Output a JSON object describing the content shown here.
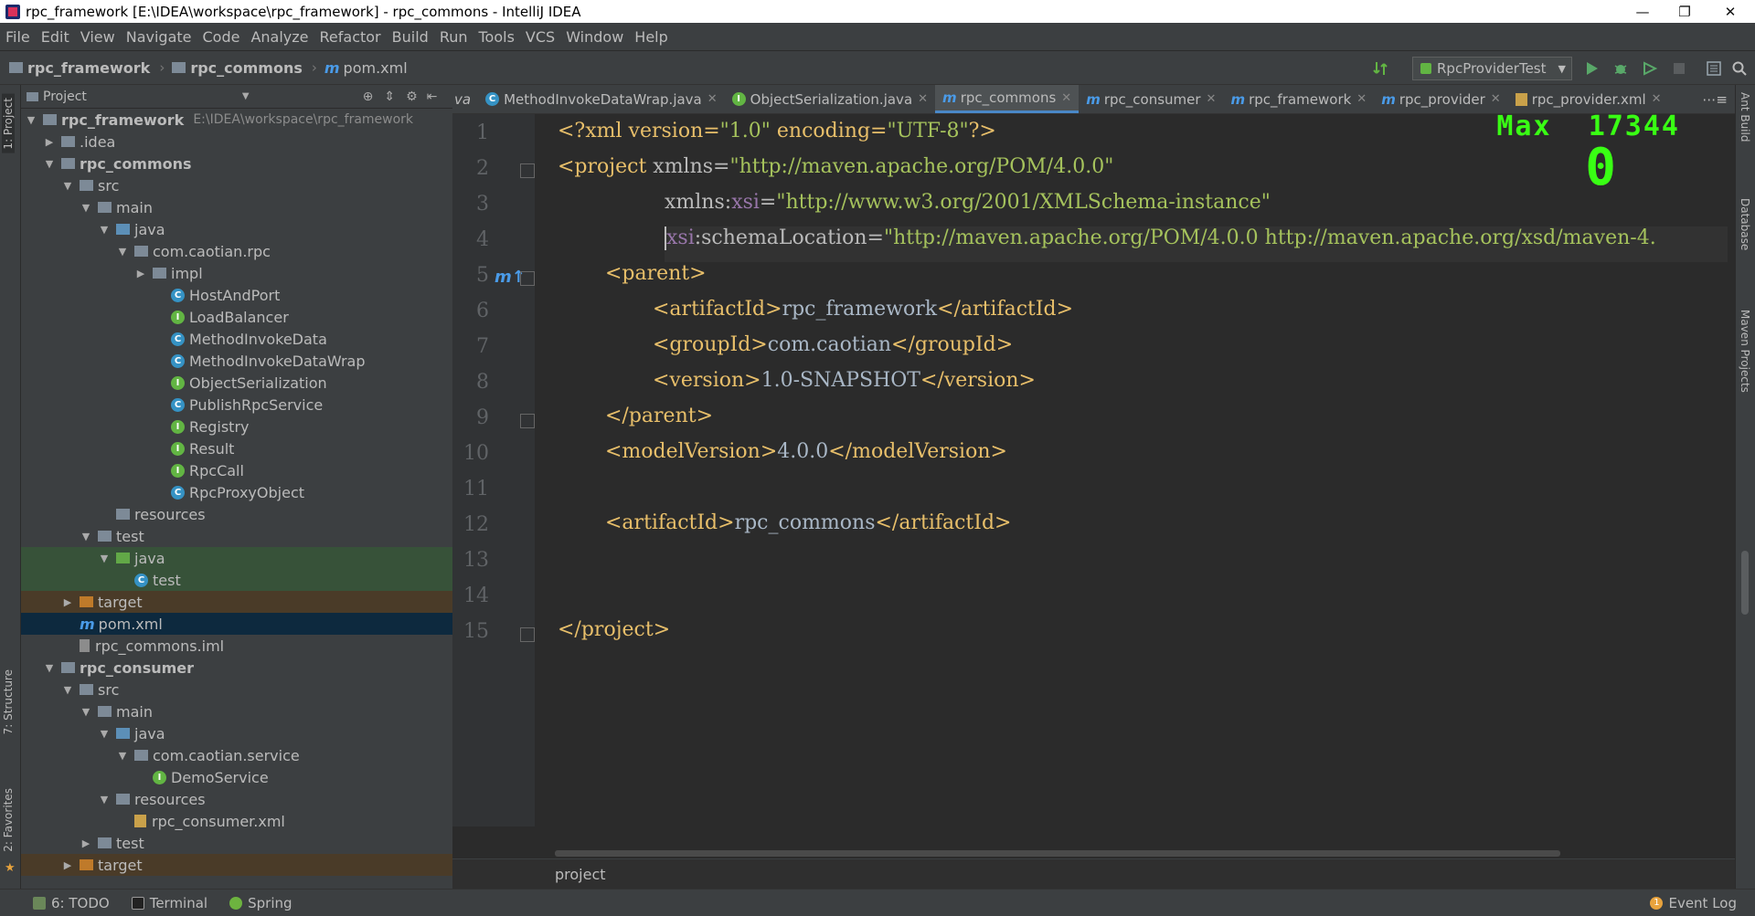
{
  "window": {
    "title": "rpc_framework [E:\\IDEA\\workspace\\rpc_framework] - rpc_commons - IntelliJ IDEA",
    "minimize": "—",
    "restore": "❐",
    "close": "✕"
  },
  "menu": [
    "File",
    "Edit",
    "View",
    "Navigate",
    "Code",
    "Analyze",
    "Refactor",
    "Build",
    "Run",
    "Tools",
    "VCS",
    "Window",
    "Help"
  ],
  "breadcrumb": {
    "root": "rpc_framework",
    "module": "rpc_commons",
    "file": "pom.xml"
  },
  "run_config": "RpcProviderTest",
  "project_panel": {
    "title": "Project"
  },
  "tree": [
    {
      "label": "rpc_framework",
      "extra": "E:\\IDEA\\workspace\\rpc_framework",
      "icon": "module",
      "expanded": true,
      "bold": true
    },
    {
      "label": ".idea",
      "icon": "folder",
      "expanded": false
    },
    {
      "label": "rpc_commons",
      "icon": "module",
      "expanded": true,
      "bold": true
    },
    {
      "label": "src",
      "icon": "folder",
      "expanded": true
    },
    {
      "label": "main",
      "icon": "folder",
      "expanded": true
    },
    {
      "label": "java",
      "icon": "folder-src",
      "expanded": true
    },
    {
      "label": "com.caotian.rpc",
      "icon": "package",
      "expanded": true
    },
    {
      "label": "impl",
      "icon": "package",
      "expanded": false
    },
    {
      "label": "HostAndPort",
      "icon": "class"
    },
    {
      "label": "LoadBalancer",
      "icon": "interface"
    },
    {
      "label": "MethodInvokeData",
      "icon": "class"
    },
    {
      "label": "MethodInvokeDataWrap",
      "icon": "class"
    },
    {
      "label": "ObjectSerialization",
      "icon": "interface"
    },
    {
      "label": "PublishRpcService",
      "icon": "class"
    },
    {
      "label": "Registry",
      "icon": "interface"
    },
    {
      "label": "Result",
      "icon": "interface"
    },
    {
      "label": "RpcCall",
      "icon": "interface"
    },
    {
      "label": "RpcProxyObject",
      "icon": "class"
    },
    {
      "label": "resources",
      "icon": "folder-res"
    },
    {
      "label": "test",
      "icon": "folder",
      "expanded": true
    },
    {
      "label": "java",
      "icon": "folder-test",
      "expanded": true
    },
    {
      "label": "test",
      "icon": "class"
    },
    {
      "label": "target",
      "icon": "folder-excluded",
      "expanded": false
    },
    {
      "label": "pom.xml",
      "icon": "maven",
      "selected": true
    },
    {
      "label": "rpc_commons.iml",
      "icon": "file"
    },
    {
      "label": "rpc_consumer",
      "icon": "module",
      "expanded": true,
      "bold": true
    },
    {
      "label": "src",
      "icon": "folder",
      "expanded": true
    },
    {
      "label": "main",
      "icon": "folder",
      "expanded": true
    },
    {
      "label": "java",
      "icon": "folder-src",
      "expanded": true
    },
    {
      "label": "com.caotian.service",
      "icon": "package",
      "expanded": true
    },
    {
      "label": "DemoService",
      "icon": "interface"
    },
    {
      "label": "resources",
      "icon": "folder-res",
      "expanded": true
    },
    {
      "label": "rpc_consumer.xml",
      "icon": "xml"
    },
    {
      "label": "test",
      "icon": "folder",
      "expanded": false
    },
    {
      "label": "target",
      "icon": "folder-excluded",
      "expanded": false
    }
  ],
  "tabs": [
    {
      "label": "va",
      "type": "partial"
    },
    {
      "label": "MethodInvokeDataWrap.java",
      "type": "class"
    },
    {
      "label": "ObjectSerialization.java",
      "type": "interface"
    },
    {
      "label": "rpc_commons",
      "type": "maven",
      "active": true
    },
    {
      "label": "rpc_consumer",
      "type": "maven"
    },
    {
      "label": "rpc_framework",
      "type": "maven"
    },
    {
      "label": "rpc_provider",
      "type": "maven"
    },
    {
      "label": "rpc_provider.xml",
      "type": "xml"
    }
  ],
  "code_lines": [
    "1",
    "2",
    "3",
    "4",
    "5",
    "6",
    "7",
    "8",
    "9",
    "10",
    "11",
    "12",
    "13",
    "14",
    "15"
  ],
  "code": {
    "l1a": "<?xml version=",
    "l1b": "\"1.0\"",
    "l1c": " encoding=",
    "l1d": "\"UTF-8\"",
    "l1e": "?>",
    "l2a": "<project ",
    "l2b": "xmlns=",
    "l2c": "\"http://maven.apache.org/POM/4.0.0\"",
    "l3a": "xmlns:",
    "l3b": "xsi",
    "l3c": "=",
    "l3d": "\"http://www.w3.org/2001/XMLSchema-instance\"",
    "l4a": "xsi",
    "l4b": ":schemaLocation=",
    "l4c": "\"http://maven.apache.org/POM/4.0.0 http://maven.apache.org/xsd/maven-4.",
    "l5": "<parent>",
    "l6a": "<artifactId>",
    "l6b": "rpc_framework",
    "l6c": "</artifactId>",
    "l7a": "<groupId>",
    "l7b": "com.caotian",
    "l7c": "</groupId>",
    "l8a": "<version>",
    "l8b": "1.0-SNAPSHOT",
    "l8c": "</version>",
    "l9": "</parent>",
    "l10a": "<modelVersion>",
    "l10b": "4.0.0",
    "l10c": "</modelVersion>",
    "l12a": "<artifactId>",
    "l12b": "rpc_commons",
    "l12c": "</artifactId>",
    "l15": "</project>"
  },
  "overlay": {
    "max_label": "Max",
    "max_value": "17344",
    "combo": "0"
  },
  "editor_breadcrumb": "project",
  "left_tabs": {
    "project": "1: Project",
    "structure": "7: Structure",
    "favorites": "2: Favorites"
  },
  "right_tabs": {
    "ant": "Ant Build",
    "database": "Database",
    "maven": "Maven Projects"
  },
  "status": {
    "todo": "6: TODO",
    "terminal": "Terminal",
    "spring": "Spring",
    "event_log": "Event Log",
    "event_count": "1"
  }
}
